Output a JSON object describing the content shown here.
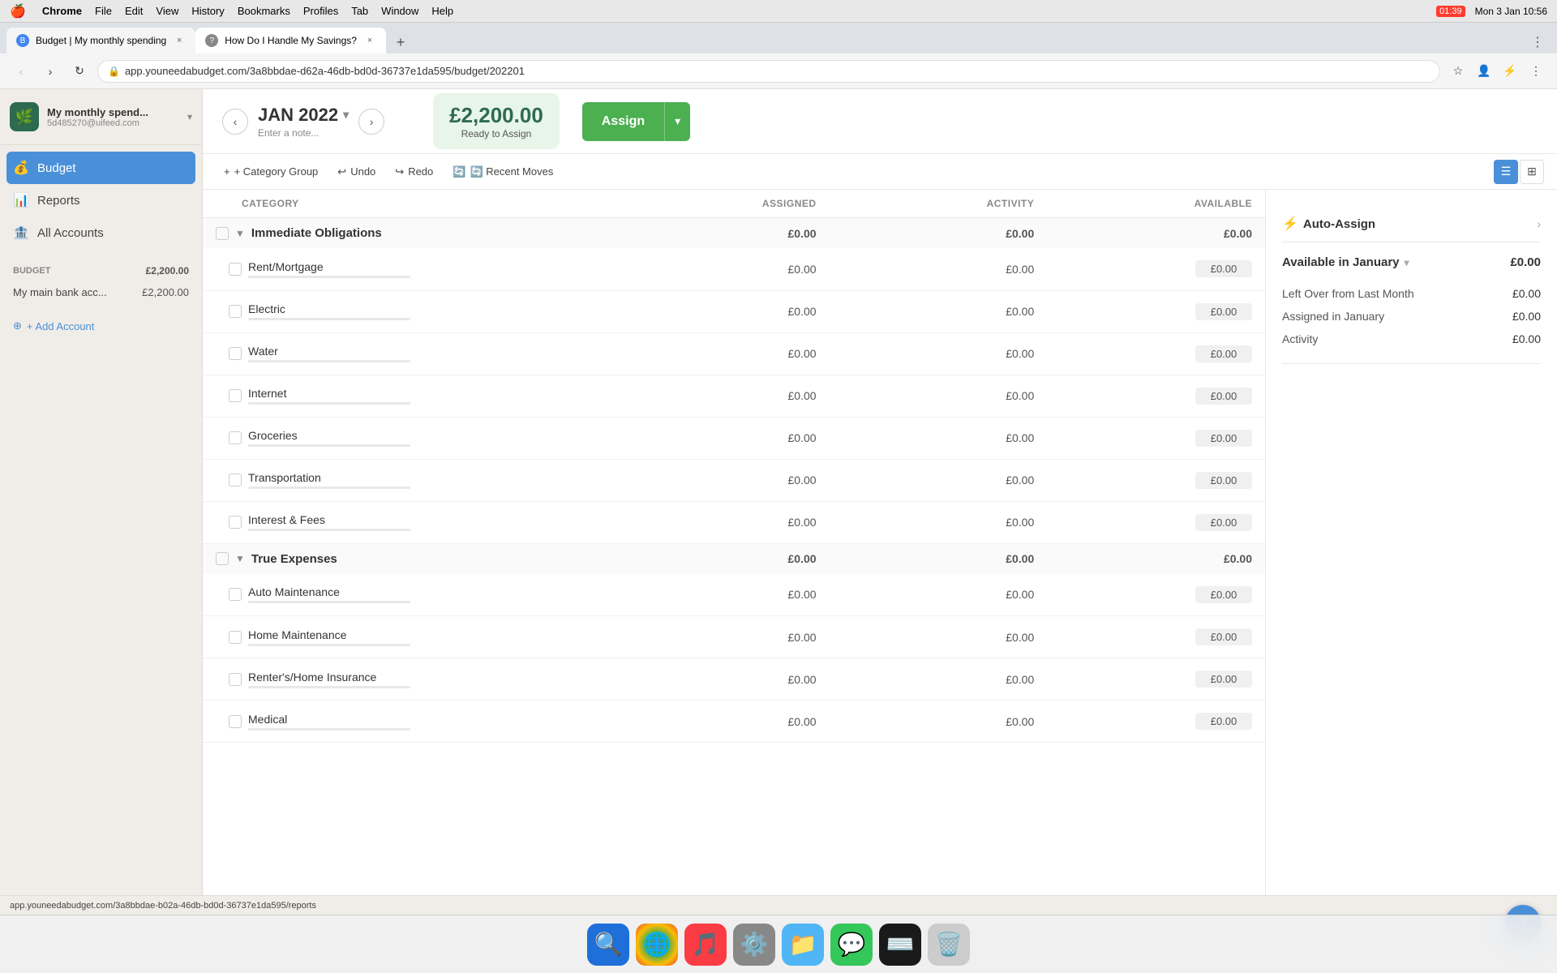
{
  "menubar": {
    "apple": "🍎",
    "app": "Chrome",
    "items": [
      "File",
      "Edit",
      "View",
      "History",
      "Bookmarks",
      "Profiles",
      "Tab",
      "Window",
      "Help"
    ],
    "time": "Mon 3 Jan  10:56",
    "battery": "01:39"
  },
  "browser": {
    "tabs": [
      {
        "id": "tab1",
        "title": "Budget | My monthly spending",
        "active": true,
        "favicon": "B"
      },
      {
        "id": "tab2",
        "title": "How Do I Handle My Savings?",
        "active": false,
        "favicon": "?"
      }
    ],
    "url": "app.youneedabudget.com/3a8bbdae-d62a-46db-bd0d-36737e1da595/budget/202201"
  },
  "sidebar": {
    "brand_name": "My monthly spend...",
    "brand_id": "5d485270@uifeed.com",
    "nav": [
      {
        "id": "budget",
        "label": "Budget",
        "icon": "💰",
        "active": true
      },
      {
        "id": "reports",
        "label": "Reports",
        "icon": "📊",
        "active": false
      },
      {
        "id": "all-accounts",
        "label": "All Accounts",
        "icon": "🏦",
        "active": false
      }
    ],
    "budget_section": {
      "label": "BUDGET",
      "amount": "£2,200.00",
      "accounts": [
        {
          "name": "My main bank acc...",
          "balance": "£2,200.00"
        }
      ]
    },
    "add_account": "+ Add Account"
  },
  "topbar": {
    "prev_btn": "‹",
    "next_btn": "›",
    "month": "JAN 2022",
    "month_dropdown": "▾",
    "note_placeholder": "Enter a note...",
    "ready_amount": "£2,200.00",
    "ready_label": "Ready to Assign",
    "assign_btn": "Assign",
    "assign_dropdown": "▾"
  },
  "toolbar": {
    "category_group": "+ Category Group",
    "undo": "↩ Undo",
    "redo": "↪ Redo",
    "recent_moves": "🔄 Recent Moves",
    "view_list": "☰",
    "view_grid": "⊞"
  },
  "table": {
    "headers": {
      "category": "CATEGORY",
      "assigned": "ASSIGNED",
      "activity": "ACTIVITY",
      "available": "AVAILABLE"
    },
    "groups": [
      {
        "id": "immediate-obligations",
        "name": "Immediate Obligations",
        "assigned": "£0.00",
        "activity": "£0.00",
        "available": "£0.00",
        "collapsed": false,
        "items": [
          {
            "name": "Rent/Mortgage",
            "assigned": "£0.00",
            "activity": "£0.00",
            "available": "£0.00"
          },
          {
            "name": "Electric",
            "assigned": "£0.00",
            "activity": "£0.00",
            "available": "£0.00"
          },
          {
            "name": "Water",
            "assigned": "£0.00",
            "activity": "£0.00",
            "available": "£0.00"
          },
          {
            "name": "Internet",
            "assigned": "£0.00",
            "activity": "£0.00",
            "available": "£0.00"
          },
          {
            "name": "Groceries",
            "assigned": "£0.00",
            "activity": "£0.00",
            "available": "£0.00"
          },
          {
            "name": "Transportation",
            "assigned": "£0.00",
            "activity": "£0.00",
            "available": "£0.00"
          },
          {
            "name": "Interest & Fees",
            "assigned": "£0.00",
            "activity": "£0.00",
            "available": "£0.00"
          }
        ]
      },
      {
        "id": "true-expenses",
        "name": "True Expenses",
        "assigned": "£0.00",
        "activity": "£0.00",
        "available": "£0.00",
        "collapsed": false,
        "items": [
          {
            "name": "Auto Maintenance",
            "assigned": "£0.00",
            "activity": "£0.00",
            "available": "£0.00"
          },
          {
            "name": "Home Maintenance",
            "assigned": "£0.00",
            "activity": "£0.00",
            "available": "£0.00"
          },
          {
            "name": "Renter's/Home Insurance",
            "assigned": "£0.00",
            "activity": "£0.00",
            "available": "£0.00"
          },
          {
            "name": "Medical",
            "assigned": "£0.00",
            "activity": "£0.00",
            "available": "£0.00"
          }
        ]
      }
    ]
  },
  "right_panel": {
    "auto_assign_label": "Auto-Assign",
    "available_section": {
      "title": "Available in January",
      "total": "£0.00",
      "rows": [
        {
          "label": "Left Over from Last Month",
          "value": "£0.00"
        },
        {
          "label": "Assigned in January",
          "value": "£0.00"
        },
        {
          "label": "Activity",
          "value": "£0.00"
        }
      ]
    }
  },
  "statusbar": {
    "url": "app.youneedabudget.com/3a8bbdae-b02a-46db-bd0d-36737e1da595/reports"
  },
  "help_btn": "?",
  "dock": {
    "items": [
      "🔍",
      "🌐",
      "🎵",
      "⚙️",
      "📁",
      "💬"
    ]
  }
}
